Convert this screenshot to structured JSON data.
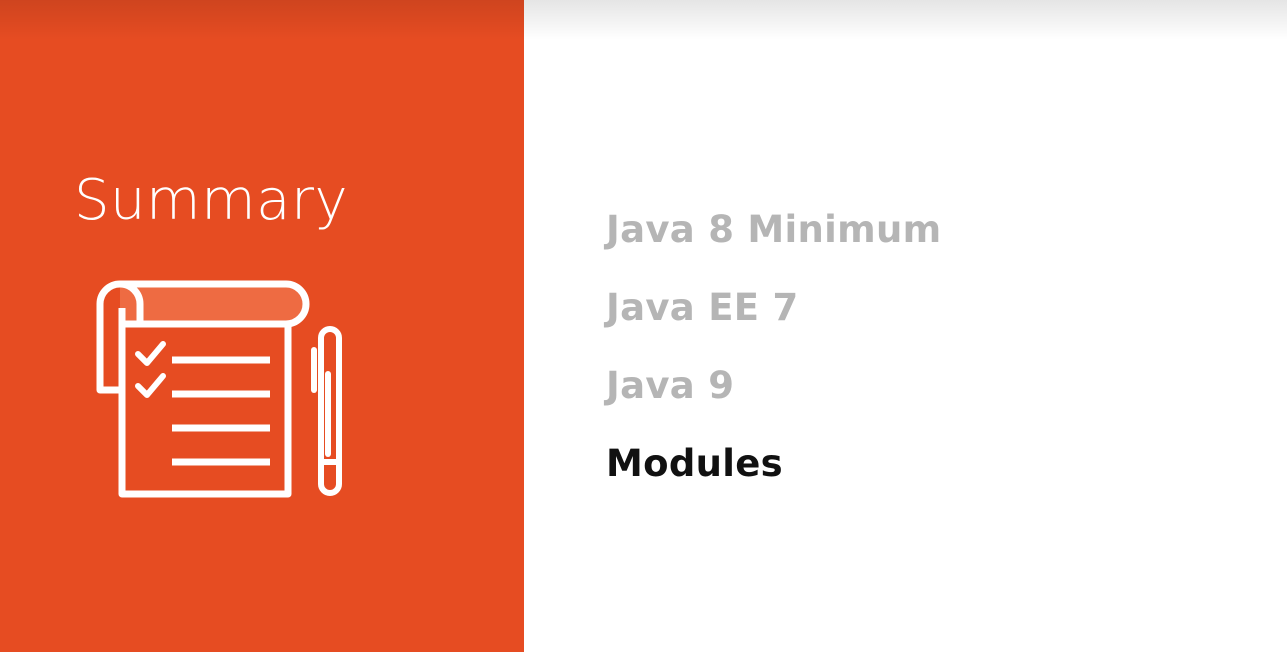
{
  "slide": {
    "title": "Summary",
    "icon": "checklist-notepad-with-pen-icon",
    "topics": [
      {
        "label": "Java 8 Minimum",
        "active": false
      },
      {
        "label": "Java EE 7",
        "active": false
      },
      {
        "label": "Java 9",
        "active": false
      },
      {
        "label": "Modules",
        "active": true
      }
    ]
  },
  "colors": {
    "accent": "#e64c22",
    "accent_light": "#ee6b42",
    "inactive_text": "#b5b5b5",
    "active_text": "#111111",
    "title_text": "#ffffff"
  }
}
